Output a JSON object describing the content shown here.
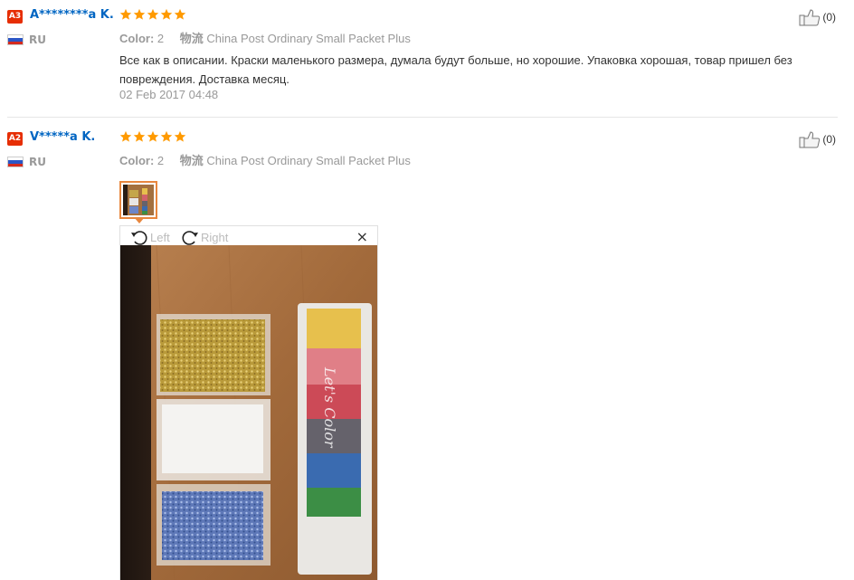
{
  "reviews": [
    {
      "badge": "A3",
      "name": "A********a K.",
      "country": "RU",
      "rating": 5,
      "color_label": "Color:",
      "color_value": "2",
      "shipping_label": "物流",
      "shipping_value": "China Post Ordinary Small Packet Plus",
      "text": "Все как в описании. Краски маленького размера, думала будут больше, но хорошие. Упаковка хорошая, товар пришел без повреждения. Доставка месяц.",
      "date": "02 Feb 2017 04:48",
      "helpful_count": "(0)"
    },
    {
      "badge": "A2",
      "name": "V*****a K.",
      "country": "RU",
      "rating": 5,
      "color_label": "Color:",
      "color_value": "2",
      "shipping_label": "物流",
      "shipping_value": "China Post Ordinary Small Packet Plus",
      "helpful_count": "(0)",
      "viewer": {
        "rotate_left": "Left",
        "rotate_right": "Right",
        "close": "×",
        "photo_text": "Let's Color"
      }
    }
  ],
  "colors": {
    "star": "#ff9a00",
    "name_link": "#0065c2",
    "badge": "#e62e04",
    "thumb_border": "#e8873e"
  },
  "icons": [
    "thumbs-up-icon",
    "rotate-left-icon",
    "rotate-right-icon",
    "close-icon",
    "star-icon",
    "russia-flag-icon"
  ]
}
